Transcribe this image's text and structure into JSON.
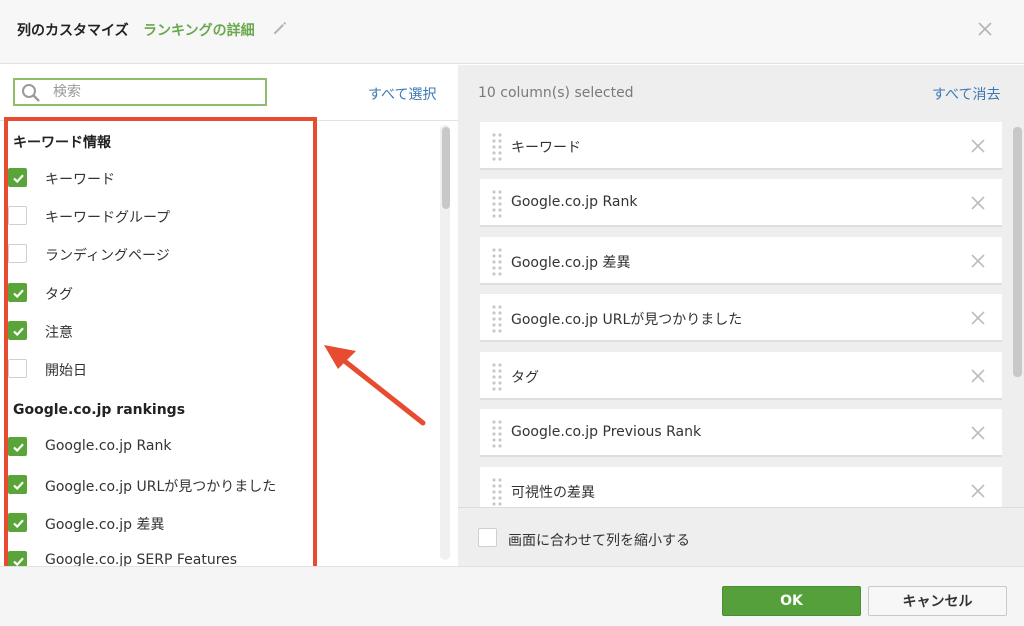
{
  "header": {
    "title": "列のカスタマイズ",
    "subtitle": "ランキングの詳細"
  },
  "left": {
    "search_placeholder": "検索",
    "select_all": "すべて選択",
    "groups": [
      {
        "heading": "キーワード情報",
        "options": [
          {
            "label": "キーワード",
            "checked": true
          },
          {
            "label": "キーワードグループ",
            "checked": false
          },
          {
            "label": "ランディングページ",
            "checked": false
          },
          {
            "label": "タグ",
            "checked": true
          },
          {
            "label": "注意",
            "checked": true
          },
          {
            "label": "開始日",
            "checked": false
          }
        ]
      },
      {
        "heading": "Google.co.jp rankings",
        "options": [
          {
            "label": "Google.co.jp Rank",
            "checked": true
          },
          {
            "label": "Google.co.jp URLが見つかりました",
            "checked": true
          },
          {
            "label": "Google.co.jp 差異",
            "checked": true
          },
          {
            "label": "Google.co.jp SERP Features",
            "checked": true
          }
        ]
      }
    ]
  },
  "right": {
    "selected_count": "10 column(s) selected",
    "clear_all": "すべて消去",
    "columns": [
      "キーワード",
      "Google.co.jp Rank",
      "Google.co.jp 差異",
      "Google.co.jp URLが見つかりました",
      "タグ",
      "Google.co.jp Previous Rank",
      "可視性の差異"
    ],
    "shrink_label": "画面に合わせて列を縮小する"
  },
  "footer": {
    "ok_label": "OK",
    "cancel_label": "キャンセル"
  },
  "colors": {
    "accent_green": "#5aa53a",
    "link_blue": "#3b78b5",
    "highlight_red": "#e84c30"
  }
}
